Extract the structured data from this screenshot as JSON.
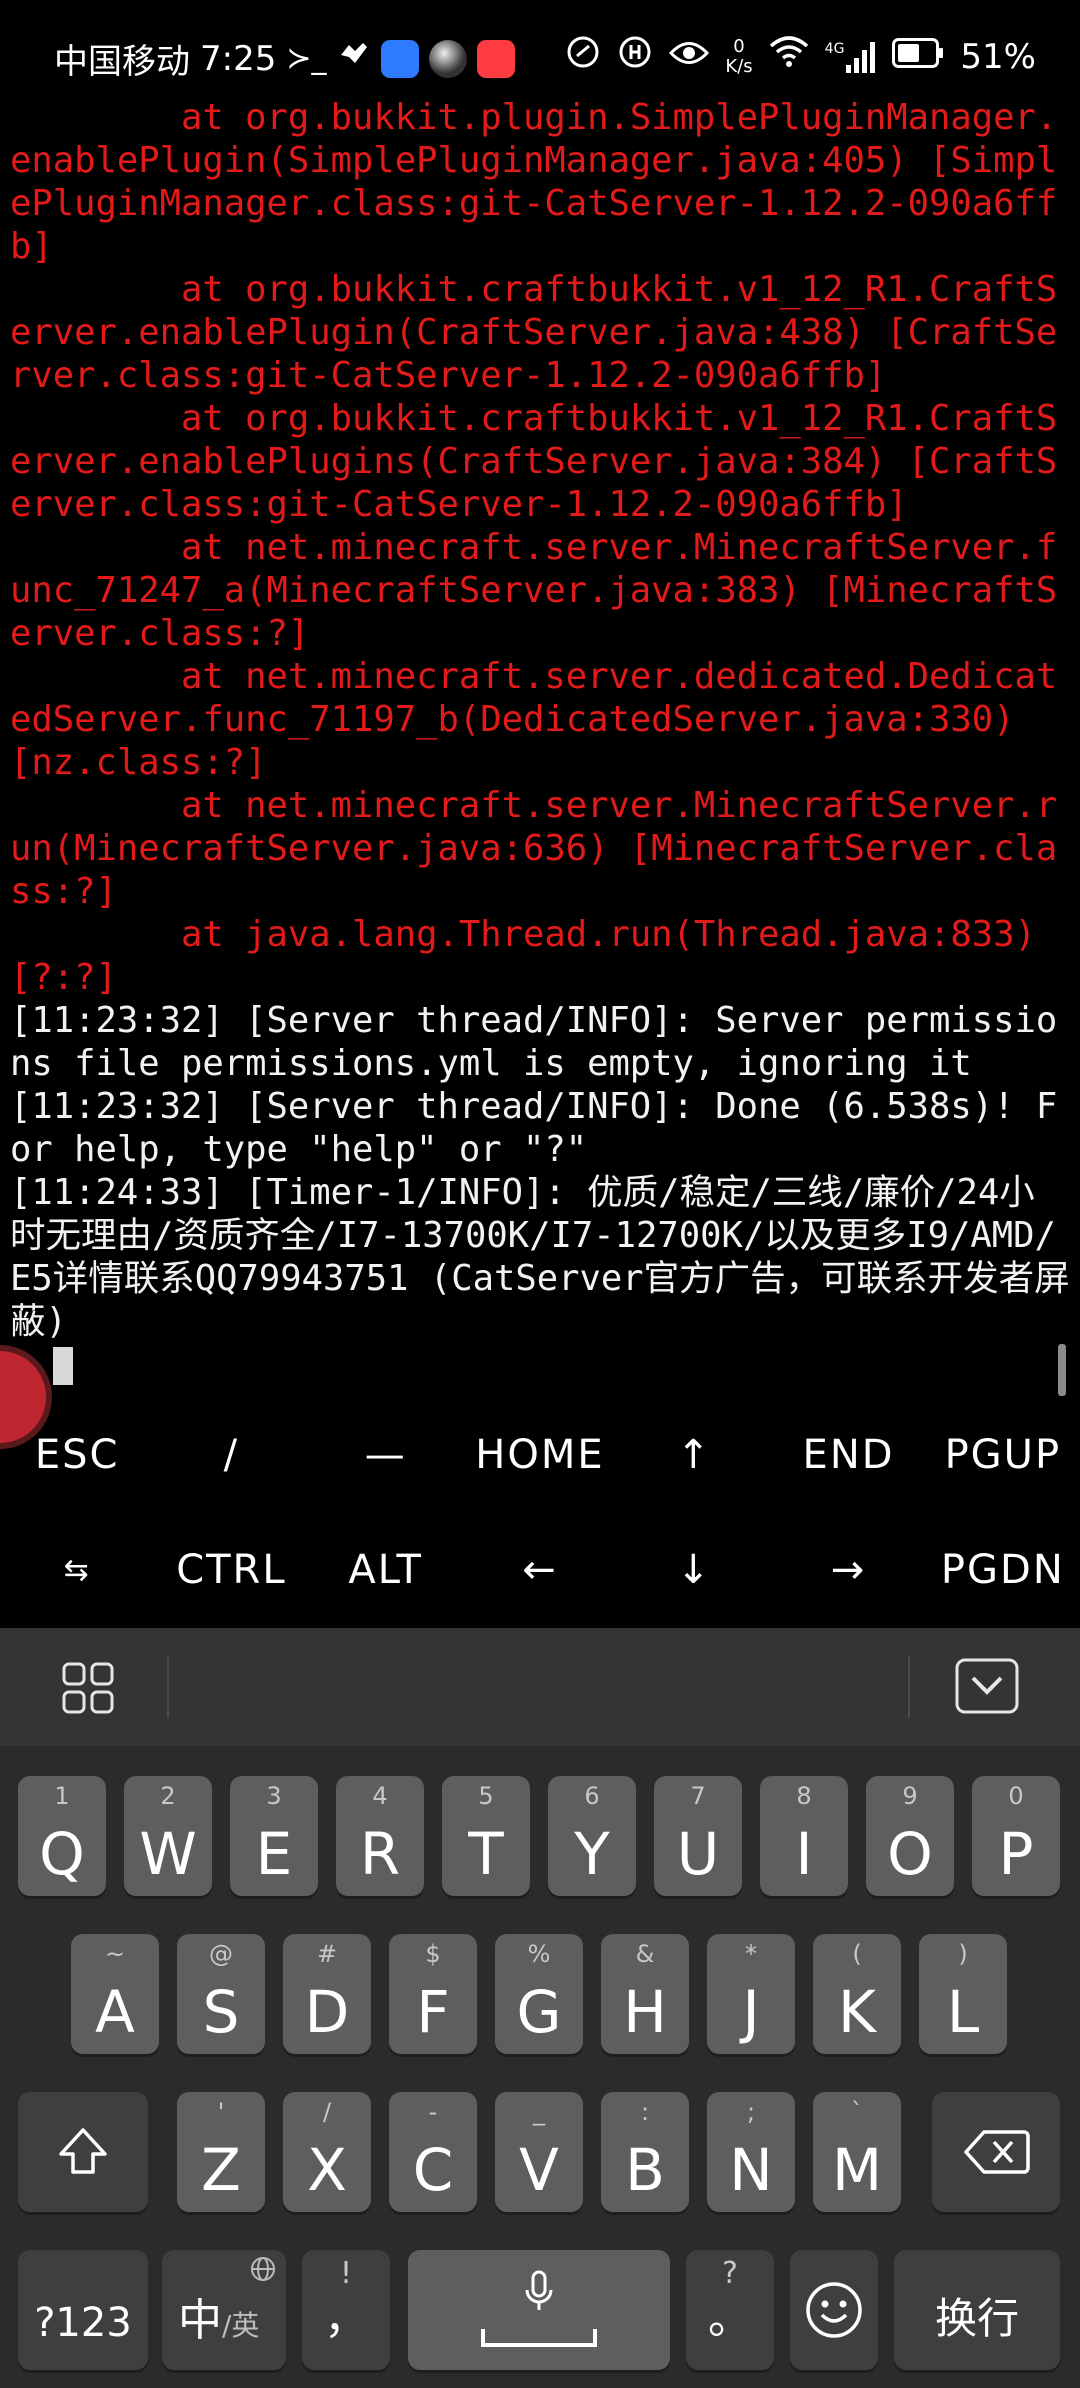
{
  "status_bar": {
    "carrier": "中国移动",
    "time": "7:25",
    "terminal_glyph": "≻_",
    "net_speed_value": "0",
    "net_speed_unit": "K/s",
    "net_type": "4G",
    "battery": "51%"
  },
  "terminal": {
    "lines": [
      {
        "cls": "err",
        "text": "        at org.bukkit.plugin.SimplePluginManager.enablePlugin(SimplePluginManager.java:405) [SimplePluginManager.class:git-CatServer-1.12.2-090a6ffb]"
      },
      {
        "cls": "err",
        "text": "        at org.bukkit.craftbukkit.v1_12_R1.CraftServer.enablePlugin(CraftServer.java:438) [CraftServer.class:git-CatServer-1.12.2-090a6ffb]"
      },
      {
        "cls": "err",
        "text": "        at org.bukkit.craftbukkit.v1_12_R1.CraftServer.enablePlugins(CraftServer.java:384) [CraftServer.class:git-CatServer-1.12.2-090a6ffb]"
      },
      {
        "cls": "err",
        "text": "        at net.minecraft.server.MinecraftServer.func_71247_a(MinecraftServer.java:383) [MinecraftServer.class:?]"
      },
      {
        "cls": "err",
        "text": "        at net.minecraft.server.dedicated.DedicatedServer.func_71197_b(DedicatedServer.java:330) [nz.class:?]"
      },
      {
        "cls": "err",
        "text": "        at net.minecraft.server.MinecraftServer.run(MinecraftServer.java:636) [MinecraftServer.class:?]"
      },
      {
        "cls": "err",
        "text": "        at java.lang.Thread.run(Thread.java:833) [?:?]"
      },
      {
        "cls": "info",
        "text": "[11:23:32] [Server thread/INFO]: Server permissions file permissions.yml is empty, ignoring it"
      },
      {
        "cls": "info",
        "text": "[11:23:32] [Server thread/INFO]: Done (6.538s)! For help, type \"help\" or \"?\""
      },
      {
        "cls": "info",
        "text": "[11:24:33] [Timer-1/INFO]: 优质/稳定/三线/廉价/24小时无理由/资质齐全/I7-13700K/I7-12700K/以及更多I9/AMD/E5详情联系QQ79943751 (CatServer官方广告，可联系开发者屏蔽)"
      }
    ],
    "prompt": ">"
  },
  "extra_keys": {
    "row1": [
      "ESC",
      "/",
      "—",
      "HOME",
      "↑",
      "END",
      "PGUP"
    ],
    "row2": [
      "⇆",
      "CTRL",
      "ALT",
      "←",
      "↓",
      "→",
      "PGDN"
    ]
  },
  "keyboard": {
    "row1": [
      {
        "hint": "1",
        "label": "Q"
      },
      {
        "hint": "2",
        "label": "W"
      },
      {
        "hint": "3",
        "label": "E"
      },
      {
        "hint": "4",
        "label": "R"
      },
      {
        "hint": "5",
        "label": "T"
      },
      {
        "hint": "6",
        "label": "Y"
      },
      {
        "hint": "7",
        "label": "U"
      },
      {
        "hint": "8",
        "label": "I"
      },
      {
        "hint": "9",
        "label": "O"
      },
      {
        "hint": "0",
        "label": "P"
      }
    ],
    "row2": [
      {
        "hint": "~",
        "label": "A"
      },
      {
        "hint": "@",
        "label": "S"
      },
      {
        "hint": "#",
        "label": "D"
      },
      {
        "hint": "$",
        "label": "F"
      },
      {
        "hint": "%",
        "label": "G"
      },
      {
        "hint": "&",
        "label": "H"
      },
      {
        "hint": "*",
        "label": "J"
      },
      {
        "hint": "(",
        "label": "K"
      },
      {
        "hint": ")",
        "label": "L"
      }
    ],
    "row3": [
      {
        "hint": "'",
        "label": "Z"
      },
      {
        "hint": "/",
        "label": "X"
      },
      {
        "hint": "-",
        "label": "C"
      },
      {
        "hint": "_",
        "label": "V"
      },
      {
        "hint": ":",
        "label": "B"
      },
      {
        "hint": ";",
        "label": "N"
      },
      {
        "hint": "`",
        "label": "M"
      }
    ],
    "numbers_label": "?123",
    "lang_main": "中",
    "lang_alt": "/英",
    "comma_hint": "!",
    "comma_label": "，",
    "period_hint": "?",
    "period_label": "。",
    "enter_label": "换行"
  }
}
